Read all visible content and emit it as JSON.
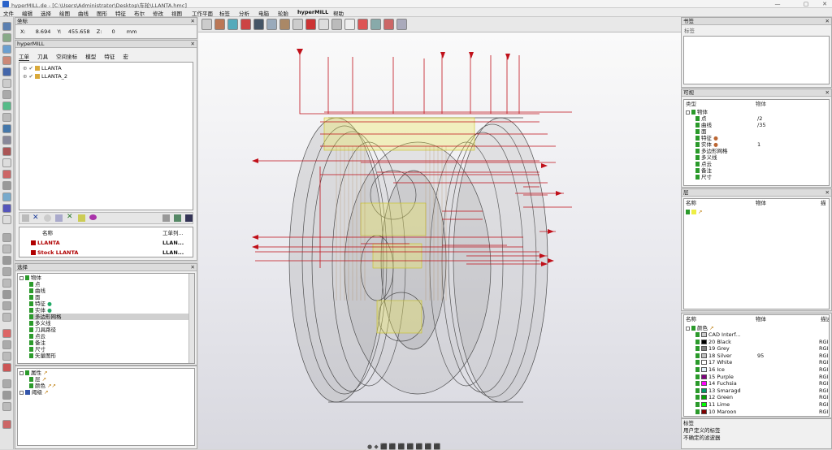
{
  "titlebar": {
    "title": "hyperMILL.de - [C:\\Users\\Administrator\\Desktop\\车轮\\LLANTA.hmc]",
    "minimize": "—",
    "maximize": "▢",
    "close": "✕"
  },
  "menu": [
    "文件",
    "编辑",
    "选择",
    "绘图",
    "曲线",
    "图形",
    "特征",
    "布尔",
    "修改",
    "视图",
    "工作平面",
    "标签",
    "分析",
    "电脑",
    "轮胎",
    "hyperMILL",
    "帮助"
  ],
  "coord": {
    "title": "坐标",
    "x_label": "X:",
    "x_val": "8.694",
    "y_label": "Y:",
    "y_val": "455.658",
    "z_label": "Z:",
    "z_val": "0",
    "unit": "mm"
  },
  "hm": {
    "title": "hyperMILL",
    "tabs": [
      "工单",
      "刀具",
      "空间坐标",
      "模型",
      "特征",
      "宏"
    ],
    "tree": [
      "LLANTA",
      "LLANTA_2"
    ],
    "list_headers": [
      "名称",
      "工单列..."
    ],
    "list_rows": [
      {
        "name": "LLANTA",
        "col": "LLAN..."
      },
      {
        "name": "Stock LLANTA",
        "col": "LLAN..."
      }
    ]
  },
  "selection": {
    "title": "选择",
    "items": [
      "物体",
      "点",
      "曲线",
      "面",
      "特征",
      "实体",
      "多边形网格",
      "多义线",
      "刀具路径",
      "点云",
      "备注",
      "尺寸",
      "矢量图形"
    ]
  },
  "attrs": {
    "items": [
      "属性",
      "层",
      "颜色",
      "阈级"
    ]
  },
  "viewport_bottom": {
    "hint": "● ◆ ⬛ ⬛ ⬛ ⬛ ⬛ ⬛ ⬛"
  },
  "right": {
    "bookmark": {
      "title": "书签",
      "sub": "标签"
    },
    "visible": {
      "title": "可视",
      "col1": "类型",
      "col2": "物体",
      "rows": [
        {
          "n": "物体",
          "v": ""
        },
        {
          "n": "点",
          "v": "/2"
        },
        {
          "n": "曲线",
          "v": "/35"
        },
        {
          "n": "面",
          "v": ""
        },
        {
          "n": "特征",
          "v": ""
        },
        {
          "n": "实体",
          "v": "1"
        },
        {
          "n": "多边形网格",
          "v": ""
        },
        {
          "n": "多义线",
          "v": ""
        },
        {
          "n": "点云",
          "v": ""
        },
        {
          "n": "备注",
          "v": ""
        },
        {
          "n": "尺寸",
          "v": ""
        }
      ]
    },
    "layers": {
      "title": "层",
      "col1": "名称",
      "col2": "物体",
      "col3": "描"
    },
    "colors": {
      "col1": "名称",
      "col2": "物体",
      "col3": "描述",
      "root": "颜色",
      "rows": [
        {
          "name": "CAD Interf...",
          "v": "",
          "d": "",
          "c": "#cccccc"
        },
        {
          "name": "20 Black",
          "v": "",
          "d": "RGI",
          "c": "#000000"
        },
        {
          "name": "19 Grey",
          "v": "",
          "d": "RGI",
          "c": "#808080"
        },
        {
          "name": "18 Silver",
          "v": "95",
          "d": "RGI",
          "c": "#c0c0c0"
        },
        {
          "name": "17 White",
          "v": "",
          "d": "RGI",
          "c": "#ffffff"
        },
        {
          "name": "16 Ice",
          "v": "",
          "d": "RGI",
          "c": "#dfeff7"
        },
        {
          "name": "15 Purple",
          "v": "",
          "d": "RGI",
          "c": "#800080"
        },
        {
          "name": "14 Fuchsia",
          "v": "",
          "d": "RGI",
          "c": "#ff00ff"
        },
        {
          "name": "13 Smaragd",
          "v": "",
          "d": "RGI",
          "c": "#009966"
        },
        {
          "name": "12 Green",
          "v": "",
          "d": "RGI",
          "c": "#00a000"
        },
        {
          "name": "11 Lime",
          "v": "",
          "d": "RGI",
          "c": "#00ff00"
        },
        {
          "name": "10 Maroon",
          "v": "",
          "d": "RGI",
          "c": "#800000"
        }
      ]
    },
    "bottom": [
      "标签",
      "用户定义的标签",
      "不确定的滤波器"
    ]
  }
}
